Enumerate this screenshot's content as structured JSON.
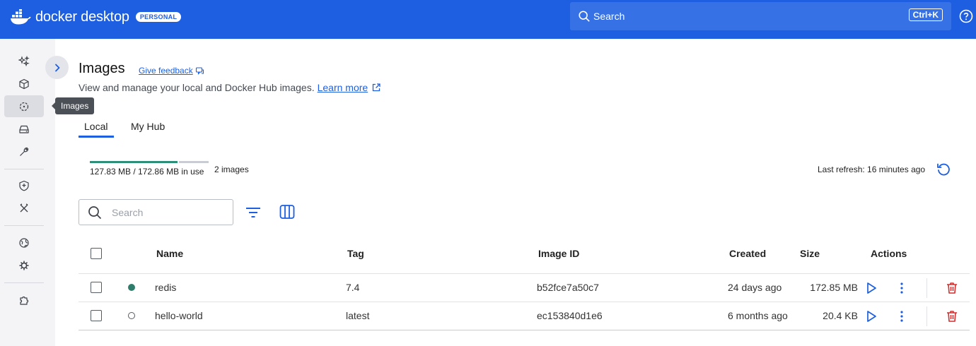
{
  "header": {
    "brand": "docker desktop",
    "plan_badge": "PERSONAL",
    "search_label": "Search",
    "search_shortcut": "Ctrl+K",
    "help_icon": "help-circle-icon"
  },
  "sidebar": {
    "items": [
      {
        "name": "ask-gordon",
        "icon": "sparkles-icon"
      },
      {
        "name": "containers",
        "icon": "cube-icon"
      },
      {
        "name": "images",
        "icon": "images-icon",
        "active": true
      },
      {
        "name": "volumes",
        "icon": "drive-icon"
      },
      {
        "name": "builds",
        "icon": "wrench-icon"
      },
      {
        "name": "scout",
        "icon": "shield-icon"
      },
      {
        "name": "models",
        "icon": "tools-icon"
      },
      {
        "name": "extensions-browse",
        "icon": "globe-icon"
      },
      {
        "name": "kubernetes",
        "icon": "helm-icon"
      },
      {
        "name": "extensions",
        "icon": "puzzle-icon"
      }
    ],
    "tooltip": "Images"
  },
  "page": {
    "title": "Images",
    "feedback_link": "Give feedback",
    "subtitle": "View and manage your local and Docker Hub images.",
    "learn_more": "Learn more",
    "tabs": [
      {
        "label": "Local",
        "active": true
      },
      {
        "label": "My Hub",
        "active": false
      }
    ]
  },
  "usage": {
    "text": "127.83 MB / 172.86 MB in use",
    "used_fraction": 0.74,
    "count": "2 images",
    "last_refresh": "Last refresh: 16 minutes ago"
  },
  "toolbar": {
    "search_placeholder": "Search"
  },
  "table": {
    "columns": [
      "Name",
      "Tag",
      "Image ID",
      "Created",
      "Size",
      "Actions"
    ],
    "rows": [
      {
        "name": "redis",
        "tag": "7.4",
        "image_id": "b52fce7a50c7",
        "created": "24 days ago",
        "size": "172.85 MB",
        "in_use": true
      },
      {
        "name": "hello-world",
        "tag": "latest",
        "image_id": "ec153840d1e6",
        "created": "6 months ago",
        "size": "20.4 KB",
        "in_use": false
      }
    ]
  },
  "colors": {
    "brand_blue": "#1d5fe0",
    "in_use_green": "#2e7d6b",
    "delete_red": "#d32f2f"
  }
}
